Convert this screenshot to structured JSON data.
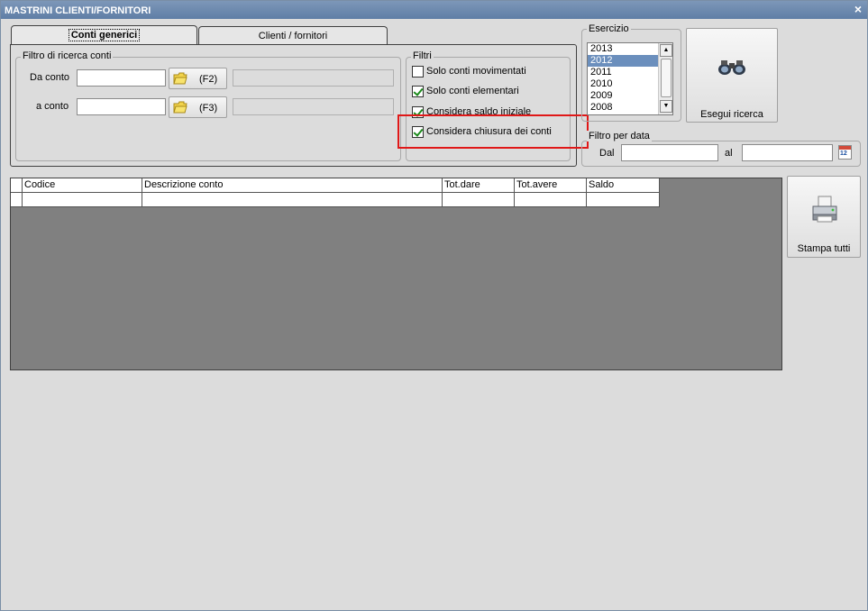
{
  "window": {
    "title": "MASTRINI CLIENTI/FORNITORI",
    "close_glyph": "×"
  },
  "tabs": [
    {
      "label": "Conti generici",
      "active": true
    },
    {
      "label": "Clienti / fornitori",
      "active": false
    }
  ],
  "filtro_ricerca": {
    "label": "Filtro di ricerca conti",
    "da_conto": {
      "label": "Da conto",
      "value": "",
      "button": "(F2)",
      "description": ""
    },
    "a_conto": {
      "label": "a conto",
      "value": "",
      "button": "(F3)",
      "description": ""
    }
  },
  "filtri": {
    "label": "Filtri",
    "options": [
      {
        "label": "Solo conti movimentati",
        "checked": false
      },
      {
        "label": "Solo conti elementari",
        "checked": true
      },
      {
        "label": "Considera saldo iniziale",
        "checked": true
      },
      {
        "label": "Considera chiusura dei conti",
        "checked": true
      }
    ]
  },
  "esercizio": {
    "label": "Esercizio",
    "years": [
      "2013",
      "2012",
      "2011",
      "2010",
      "2009",
      "2008"
    ],
    "selected": "2012"
  },
  "search_button": {
    "label": "Esegui ricerca",
    "icon": "binoculars-icon"
  },
  "filtro_data": {
    "label": "Filtro per data",
    "dal_label": "Dal",
    "dal_value": "",
    "al_label": "al",
    "al_value": "",
    "calendar_icon": "calendar-icon",
    "calendar_day": "12"
  },
  "grid": {
    "columns": [
      "Codice",
      "Descrizione conto",
      "Tot.dare",
      "Tot.avere",
      "Saldo"
    ],
    "rows": [
      [
        "",
        "",
        "",
        "",
        ""
      ]
    ]
  },
  "print_button": {
    "label": "Stampa tutti",
    "icon": "printer-icon"
  },
  "colors": {
    "titlebar": "#6b88ae",
    "highlight": "#e01818",
    "selection": "#6b8fbd",
    "grid_bg": "#808080"
  }
}
